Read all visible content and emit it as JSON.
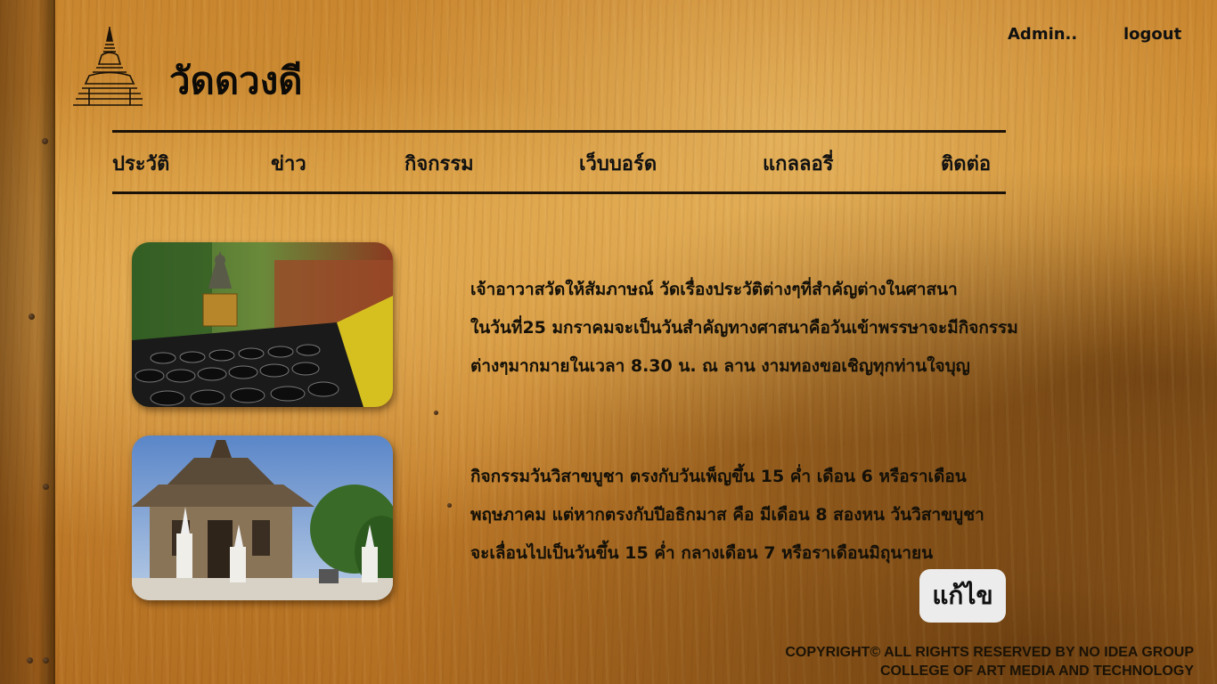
{
  "site": {
    "title": "วัดดวงดี"
  },
  "header": {
    "admin_label": "Admin..",
    "logout_label": "logout"
  },
  "nav": {
    "items": [
      {
        "label": "ประวัติ"
      },
      {
        "label": "ข่าว"
      },
      {
        "label": "กิจกรรม"
      },
      {
        "label": "เว็บบอร์ด"
      },
      {
        "label": "แกลลอรี่"
      },
      {
        "label": "ติดต่อ"
      }
    ]
  },
  "posts": [
    {
      "lines": [
        "เจ้าอาวาสวัดให้สัมภาษณ์ วัดเรื่องประวัติต่างๆที่สำคัญต่างในศาสนา",
        "ในวันที่25 มกราคมจะเป็นวันสำคัญทางศาสนาคือวันเข้าพรรษาจะมีกิจกรรม",
        "ต่างๆมากมายในเวลา 8.30 น. ณ ลาน งามทองขอเชิญทุกท่านใจบุญ"
      ]
    },
    {
      "lines": [
        "กิจกรรมวันวิสาขบูชา ตรงกับวันเพ็ญขึ้น 15 ค่ำ เดือน 6 หรือราเดือน",
        "พฤษภาคม แต่หากตรงกับปีอธิกมาส คือ มีเดือน 8 สองหน วันวิสาขบูชา",
        "จะเลื่อนไปเป็นวันขึ้น 15 ค่ำ กลางเดือน 7 หรือราเดือนมิถุนายน"
      ]
    }
  ],
  "edit_button": {
    "label": "แก้ไข"
  },
  "footer": {
    "line1": "COPYRIGHT©  ALL RIGHTS RESERVED BY NO IDEA GROUP",
    "line2": "COLLEGE OF ART MEDIA AND TECHNOLOGY"
  }
}
